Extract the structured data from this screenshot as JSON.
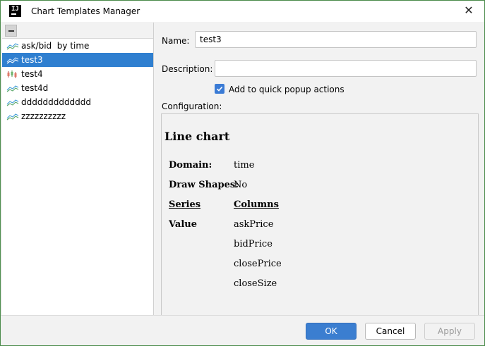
{
  "window": {
    "title": "Chart Templates Manager",
    "app_icon_text": "IJ"
  },
  "templates": [
    {
      "label": "ask/bid  by time",
      "icon": "line-chart-icon",
      "selected": false
    },
    {
      "label": "test3",
      "icon": "line-chart-icon",
      "selected": true
    },
    {
      "label": "test4",
      "icon": "candlestick-chart-icon",
      "selected": false
    },
    {
      "label": "test4d",
      "icon": "line-chart-icon",
      "selected": false
    },
    {
      "label": "ddddddddddddd",
      "icon": "line-chart-icon",
      "selected": false
    },
    {
      "label": "zzzzzzzzzz",
      "icon": "line-chart-icon",
      "selected": false
    }
  ],
  "form": {
    "name_label": "Name:",
    "name_value": "test3",
    "description_label": "Description:",
    "description_value": "",
    "quick_popup_label": "Add to quick popup actions",
    "quick_popup_checked": true,
    "configuration_label": "Configuration:"
  },
  "configuration": {
    "title": "Line chart",
    "domain_key": "Domain:",
    "domain_value": "time",
    "draw_shapes_key": "Draw Shapes:",
    "draw_shapes_value": "No",
    "series_header": "Series",
    "columns_header": "Columns",
    "series_name": "Value",
    "columns": [
      "askPrice",
      "bidPrice",
      "closePrice",
      "closeSize"
    ]
  },
  "buttons": {
    "ok": "OK",
    "cancel": "Cancel",
    "apply": "Apply"
  },
  "colors": {
    "selection": "#2f7fd0",
    "primary_button": "#3b7ed0",
    "checkbox": "#3a7bd5"
  }
}
